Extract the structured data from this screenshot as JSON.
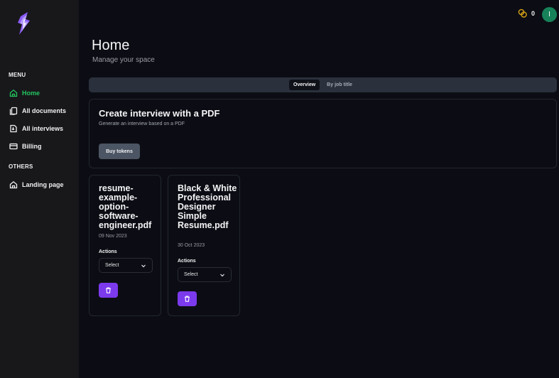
{
  "sidebar": {
    "menu_label": "MENU",
    "others_label": "OTHERS",
    "items": [
      {
        "label": "Home",
        "icon": "home-icon"
      },
      {
        "label": "All documents",
        "icon": "documents-icon"
      },
      {
        "label": "All interviews",
        "icon": "interviews-icon"
      },
      {
        "label": "Billing",
        "icon": "credit-card-icon"
      }
    ],
    "others": [
      {
        "label": "Landing page",
        "icon": "home-icon"
      }
    ]
  },
  "topbar": {
    "tokens": "0",
    "avatar_initial": "I",
    "coin_color": "#d4a017",
    "avatar_color": "#17825a"
  },
  "header": {
    "title": "Home",
    "subtitle": "Manage your space"
  },
  "tabs": [
    {
      "label": "Overview",
      "active": true
    },
    {
      "label": "By job title",
      "active": false
    }
  ],
  "create_card": {
    "title": "Create interview with a PDF",
    "description": "Generate an interview based on a PDF",
    "button_label": "Buy tokens"
  },
  "documents": [
    {
      "name": "resume-example-option-software-engineer.pdf",
      "date": "09 Nov 2023",
      "actions_label": "Actions",
      "select_value": "Select"
    },
    {
      "name": "Black & White Professional Designer Simple Resume.pdf",
      "date": "30 Oct 2023",
      "actions_label": "Actions",
      "select_value": "Select"
    }
  ],
  "colors": {
    "accent_green": "#22c55e",
    "accent_purple": "#7c3aed",
    "background": "#0c0d14",
    "sidebar": "#18181b"
  }
}
